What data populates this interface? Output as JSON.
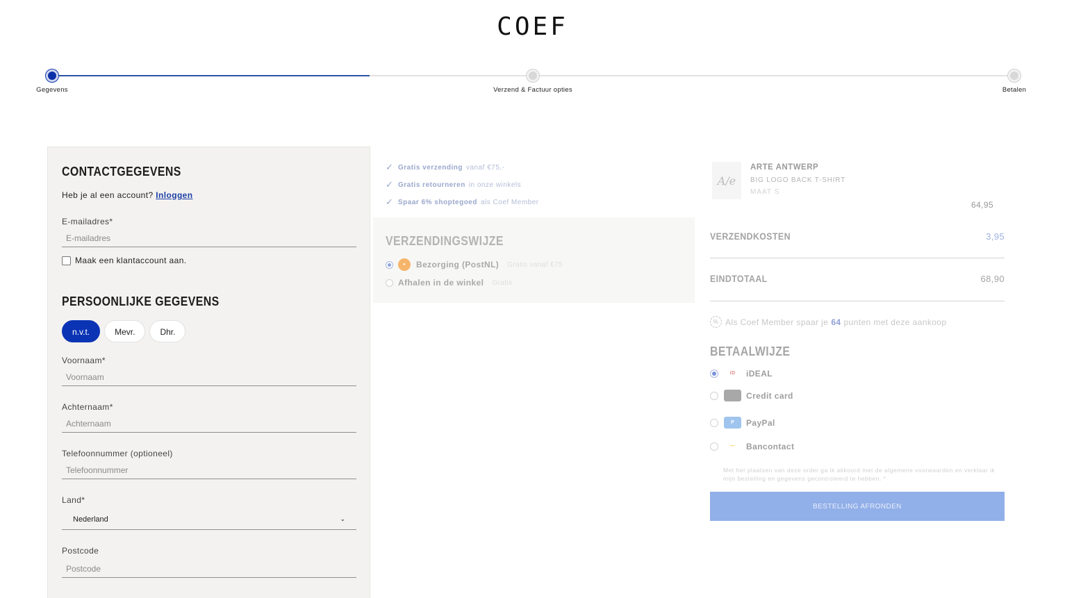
{
  "header": {
    "logo": "COEF"
  },
  "progress": {
    "steps": [
      {
        "label": "Gegevens",
        "state": "active"
      },
      {
        "label": "Verzend & Factuur opties",
        "state": "inactive"
      },
      {
        "label": "Betalen",
        "state": "inactive"
      }
    ],
    "accent_color": "#0b2fa8"
  },
  "contact": {
    "title": "CONTACTGEGEVENS",
    "account_prompt": "Heb je al een account?",
    "login_link": "Inloggen",
    "email_label": "E-mailadres*",
    "email_placeholder": "E-mailadres",
    "create_account_label": "Maak een klantaccount aan."
  },
  "personal": {
    "title": "PERSOONLIJKE GEGEVENS",
    "salutations": [
      "n.v.t.",
      "Mevr.",
      "Dhr."
    ],
    "selected_salutation": "n.v.t.",
    "firstname_label": "Voornaam*",
    "firstname_placeholder": "Voornaam",
    "lastname_label": "Achternaam*",
    "lastname_placeholder": "Achternaam",
    "phone_label": "Telefoonnummer (optioneel)",
    "phone_placeholder": "Telefoonnummer",
    "country_label": "Land*",
    "country_value": "Nederland",
    "postcode_label": "Postcode",
    "postcode_placeholder": "Postcode"
  },
  "usps": [
    {
      "bold": "Gratis verzending",
      "rest": "vanaf €75,-"
    },
    {
      "bold": "Gratis retourneren",
      "rest": "in onze winkels"
    },
    {
      "bold": "Spaar 6% shoptegoed",
      "rest": "als Coef Member"
    }
  ],
  "shipping": {
    "title": "VERZENDINGSWIJZE",
    "options": [
      {
        "label": "Bezorging (PostNL)",
        "sub": "Gratis vanaf €75",
        "selected": true
      },
      {
        "label": "Afhalen in de winkel",
        "sub": "Gratis",
        "selected": false
      }
    ]
  },
  "order": {
    "product": {
      "image_text": "A/e",
      "brand": "ARTE ANTWERP",
      "name": "BIG LOGO BACK T-SHIRT",
      "size": "MAAT  S",
      "price": "64,95"
    },
    "shipping_label": "VERZENDKOSTEN",
    "shipping_cost": "3,95",
    "total_label": "EINDTOTAAL",
    "total": "68,90",
    "member_prefix": "Als Coef Member spaar je",
    "member_points": "64",
    "member_suffix": "punten met deze aankoop"
  },
  "payment": {
    "title": "BETAALWIJZE",
    "methods": [
      {
        "label": "iDEAL",
        "icon": "ideal-icon",
        "selected": true
      },
      {
        "label": "Credit card",
        "icon": "credit-card-icon",
        "selected": false
      },
      {
        "label": "PayPal",
        "icon": "paypal-icon",
        "selected": false
      },
      {
        "label": "Bancontact",
        "icon": "bancontact-icon",
        "selected": false
      }
    ],
    "terms": "Met het plaatsen van deze order ga ik akkoord met de algemene voorwaarden en verklaar ik mijn bestelling en gegevens gecontroleerd te hebben. *",
    "submit_label": "BESTELLING AFRONDEN",
    "button_color": "#91afe8"
  }
}
